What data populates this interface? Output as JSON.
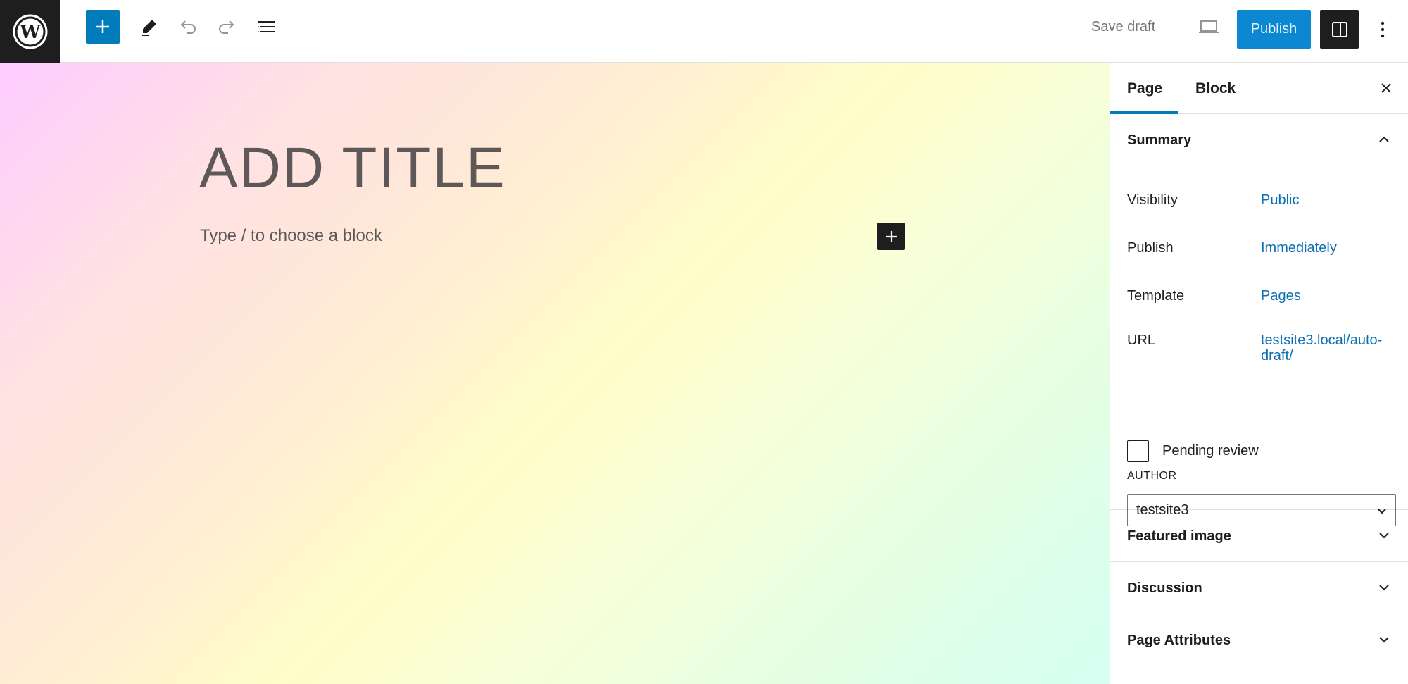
{
  "toolbar": {
    "save_draft_label": "Save draft",
    "publish_label": "Publish",
    "accent_color": "#007cba"
  },
  "editor": {
    "title_placeholder": "ADD TITLE",
    "block_placeholder": "Type / to choose a block"
  },
  "sidebar": {
    "tabs": [
      {
        "label": "Page",
        "active": true
      },
      {
        "label": "Block",
        "active": false
      }
    ],
    "summary": {
      "heading": "Summary",
      "rows": [
        {
          "label": "Visibility",
          "value": "Public"
        },
        {
          "label": "Publish",
          "value": "Immediately"
        },
        {
          "label": "Template",
          "value": "Pages"
        },
        {
          "label": "URL",
          "value": "testsite3.local/auto-draft/"
        }
      ],
      "pending_review_label": "Pending review",
      "pending_review_checked": false,
      "author_label": "AUTHOR",
      "author_value": "testsite3"
    },
    "panels": [
      {
        "label": "Featured image"
      },
      {
        "label": "Discussion"
      },
      {
        "label": "Page Attributes"
      }
    ]
  },
  "icons": [
    "wordpress-logo-icon",
    "plus-icon",
    "pencil-icon",
    "undo-icon",
    "redo-icon",
    "list-view-icon",
    "desktop-preview-icon",
    "sidebar-toggle-icon",
    "more-vertical-icon",
    "close-icon",
    "chevron-up-icon",
    "chevron-down-icon"
  ]
}
